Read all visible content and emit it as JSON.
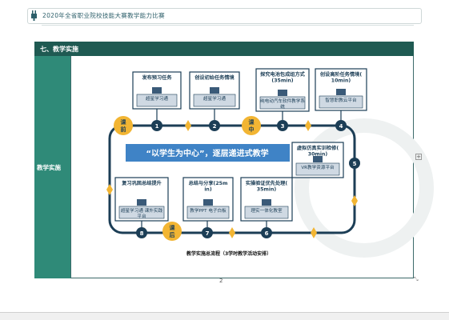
{
  "header": {
    "title": "2020年全省职业院校技能大赛教学能力比赛"
  },
  "section": {
    "title": "七、教学实施",
    "side_label": "教学实施"
  },
  "diagram": {
    "center_text": "“以学生为中心”，逐层递进式教学",
    "caption": "教学实施总流程（3学时教学活动安排）",
    "phases": {
      "pre": [
        "课",
        "前"
      ],
      "mid": [
        "课",
        "中"
      ],
      "post": [
        "课",
        "后"
      ]
    },
    "steps": [
      {
        "num": "1",
        "title": "发布预习任务",
        "platform": "超星学习通"
      },
      {
        "num": "2",
        "title": "创设初始任务情境",
        "platform": "超星学习通"
      },
      {
        "num": "3",
        "title": "探究电池包成组方式(35min)",
        "platform": "纯电动汽车软件教学系统"
      },
      {
        "num": "4",
        "title": "创设高阶任务情境(10min)",
        "platform": "智慧职教云平台"
      },
      {
        "num": "5",
        "title": "虚拟仿真实训检修(30min)",
        "platform": "VR教学资源平台"
      },
      {
        "num": "6",
        "title": "实操验证优先处理(35min)",
        "platform": "理实一体化教室"
      },
      {
        "num": "7",
        "title": "总结与分享(25min)",
        "platform": "教学PPT 电子白板"
      },
      {
        "num": "8",
        "title": "复习巩固总结提升",
        "platform": "超星学习通 课外实践平台"
      }
    ]
  },
  "colors": {
    "accent": "#1f5a52",
    "side": "#2f8a78",
    "blue": "#3f83c6",
    "gold": "#f2b533",
    "navy": "#1c3e56"
  },
  "misc": {
    "page_mark": "2"
  }
}
